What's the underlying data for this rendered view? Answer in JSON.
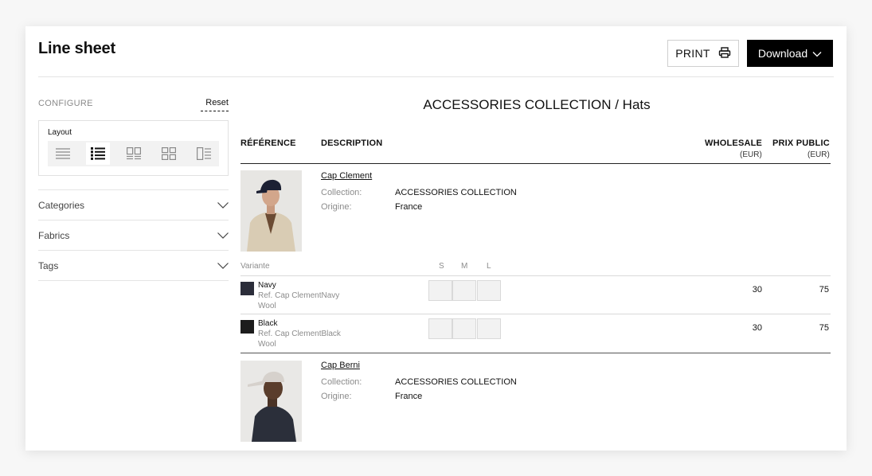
{
  "header": {
    "title": "Line sheet",
    "print_label": "PRINT",
    "download_label": "Download"
  },
  "sidebar": {
    "configure_label": "CONFIGURE",
    "reset_label": "Reset",
    "layout_label": "Layout",
    "layout_options": [
      "list-compact-icon",
      "list-detailed-icon",
      "grid-large-icon",
      "grid-small-icon",
      "detail-panel-icon"
    ],
    "layout_selected": 1,
    "filters": [
      {
        "label": "Categories"
      },
      {
        "label": "Fabrics"
      },
      {
        "label": "Tags"
      }
    ]
  },
  "main": {
    "collection_title": "ACCESSORIES COLLECTION / Hats",
    "columns": {
      "reference": "RÉFÉRENCE",
      "description": "DESCRIPTION",
      "wholesale": "WHOLESALE",
      "wholesale_unit": "(EUR)",
      "retail": "PRIX PUBLIC",
      "retail_unit": "(EUR)"
    },
    "variant_header": "Variante",
    "sizes": [
      "S",
      "M",
      "L"
    ],
    "products": [
      {
        "name": "Cap Clement",
        "collection_label": "Collection:",
        "collection": "ACCESSORIES COLLECTION",
        "origin_label": "Origine:",
        "origin": "France",
        "variants": [
          {
            "name": "Navy",
            "ref": "Ref. Cap ClementNavy",
            "material": "Wool",
            "color": "#2b2d3a",
            "wholesale": "30",
            "retail": "75"
          },
          {
            "name": "Black",
            "ref": "Ref. Cap ClementBlack",
            "material": "Wool",
            "color": "#1c1c1c",
            "wholesale": "30",
            "retail": "75"
          }
        ]
      },
      {
        "name": "Cap Berni",
        "collection_label": "Collection:",
        "collection": "ACCESSORIES COLLECTION",
        "origin_label": "Origine:",
        "origin": "France"
      }
    ]
  },
  "colors": {
    "accent": "#000000",
    "border": "#e4e4e4",
    "muted": "#8c8c8c"
  }
}
